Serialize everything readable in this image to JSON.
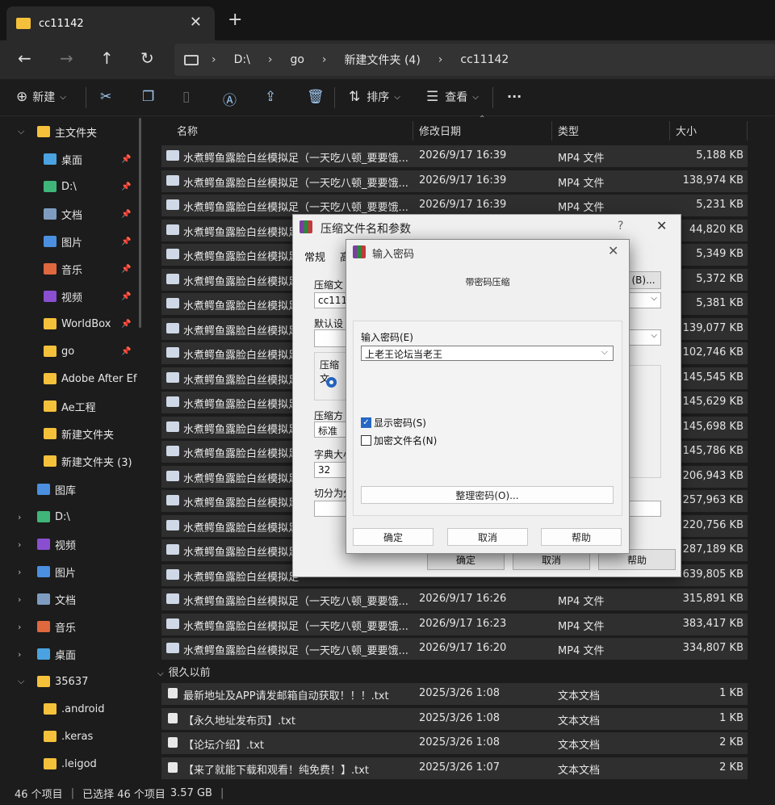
{
  "window": {
    "tab_title": "cc11142",
    "tab_close": "✕",
    "new_tab": "+"
  },
  "nav": {
    "back": "←",
    "forward": "→",
    "up": "↑",
    "refresh": "↻",
    "breadcrumbs": [
      "D:\\",
      "go",
      "新建文件夹 (4)",
      "cc11142"
    ],
    "separator": "›"
  },
  "toolbar": {
    "new_label": "新建",
    "sort_label": "排序",
    "view_label": "查看",
    "more_label": "···",
    "icons": [
      "cut-icon",
      "copy-icon",
      "paste-icon",
      "rename-icon",
      "share-icon",
      "delete-icon"
    ]
  },
  "sidebar": {
    "items": [
      {
        "label": "主文件夹",
        "icon": "home-icon",
        "color": "#f5c13b",
        "expanded": true
      },
      {
        "label": "桌面",
        "icon": "desktop-icon",
        "color": "#4aa3e0",
        "pinned": true
      },
      {
        "label": "D:\\",
        "icon": "download-icon",
        "color": "#3fb57a",
        "pinned": true
      },
      {
        "label": "文档",
        "icon": "document-icon",
        "color": "#7e9cc0",
        "pinned": true
      },
      {
        "label": "图片",
        "icon": "picture-icon",
        "color": "#4a8fe0",
        "pinned": true
      },
      {
        "label": "音乐",
        "icon": "music-icon",
        "color": "#e0683f",
        "pinned": true
      },
      {
        "label": "视频",
        "icon": "video-icon",
        "color": "#8a4fd0",
        "pinned": true
      },
      {
        "label": "WorldBox",
        "icon": "folder-icon",
        "color": "#f5c13b",
        "pinned": true
      },
      {
        "label": "go",
        "icon": "folder-icon",
        "color": "#f5c13b",
        "pinned": true
      },
      {
        "label": "Adobe After Ef",
        "icon": "folder-icon",
        "color": "#f5c13b"
      },
      {
        "label": "Ae工程",
        "icon": "folder-icon",
        "color": "#f5c13b"
      },
      {
        "label": "新建文件夹",
        "icon": "folder-icon",
        "color": "#f5c13b"
      },
      {
        "label": "新建文件夹 (3)",
        "icon": "folder-icon",
        "color": "#f5c13b"
      },
      {
        "label": "图库",
        "icon": "gallery-icon",
        "color": "#4a8fe0"
      },
      {
        "label": "D:\\",
        "icon": "download-icon",
        "color": "#3fb57a",
        "collapsed": true
      },
      {
        "label": "视频",
        "icon": "video-icon",
        "color": "#8a4fd0",
        "collapsed": true
      },
      {
        "label": "图片",
        "icon": "picture-icon",
        "color": "#4a8fe0",
        "collapsed": true
      },
      {
        "label": "文档",
        "icon": "document-icon",
        "color": "#7e9cc0",
        "collapsed": true
      },
      {
        "label": "音乐",
        "icon": "music-icon",
        "color": "#e0683f",
        "collapsed": true
      },
      {
        "label": "桌面",
        "icon": "desktop-icon",
        "color": "#4aa3e0",
        "collapsed": true
      },
      {
        "label": "35637",
        "icon": "folder-icon",
        "color": "#f5c13b",
        "expanded": true
      },
      {
        "label": ".android",
        "icon": "folder-icon",
        "color": "#f5c13b"
      },
      {
        "label": ".keras",
        "icon": "folder-icon",
        "color": "#f5c13b"
      },
      {
        "label": ".leigod",
        "icon": "folder-icon",
        "color": "#f5c13b"
      }
    ]
  },
  "columns": {
    "name": "名称",
    "date": "修改日期",
    "type": "类型",
    "size": "大小"
  },
  "files": [
    {
      "name": "水煮鳄鱼露脸白丝模拟足（一天吃八顿_要要饿...",
      "date": "2026/9/17 16:39",
      "type": "MP4 文件",
      "size": "5,188 KB"
    },
    {
      "name": "水煮鳄鱼露脸白丝模拟足（一天吃八顿_要要饿...",
      "date": "2026/9/17 16:39",
      "type": "MP4 文件",
      "size": "138,974 KB"
    },
    {
      "name": "水煮鳄鱼露脸白丝模拟足（一天吃八顿_要要饿...",
      "date": "2026/9/17 16:39",
      "type": "MP4 文件",
      "size": "5,231 KB"
    },
    {
      "name": "水煮鳄鱼露脸白丝模拟足",
      "date": "",
      "type": "",
      "size": "44,820 KB"
    },
    {
      "name": "水煮鳄鱼露脸白丝模拟足",
      "date": "",
      "type": "",
      "size": "5,349 KB"
    },
    {
      "name": "水煮鳄鱼露脸白丝模拟足",
      "date": "",
      "type": "",
      "size": "5,372 KB"
    },
    {
      "name": "水煮鳄鱼露脸白丝模拟足",
      "date": "",
      "type": "",
      "size": "5,381 KB"
    },
    {
      "name": "水煮鳄鱼露脸白丝模拟足",
      "date": "",
      "type": "",
      "size": "139,077 KB"
    },
    {
      "name": "水煮鳄鱼露脸白丝模拟足",
      "date": "",
      "type": "",
      "size": "102,746 KB"
    },
    {
      "name": "水煮鳄鱼露脸白丝模拟足",
      "date": "",
      "type": "",
      "size": "145,545 KB"
    },
    {
      "name": "水煮鳄鱼露脸白丝模拟足",
      "date": "",
      "type": "",
      "size": "145,629 KB"
    },
    {
      "name": "水煮鳄鱼露脸白丝模拟足",
      "date": "",
      "type": "",
      "size": "145,698 KB"
    },
    {
      "name": "水煮鳄鱼露脸白丝模拟足",
      "date": "",
      "type": "",
      "size": "145,786 KB"
    },
    {
      "name": "水煮鳄鱼露脸白丝模拟足",
      "date": "",
      "type": "",
      "size": "206,943 KB"
    },
    {
      "name": "水煮鳄鱼露脸白丝模拟足",
      "date": "",
      "type": "",
      "size": "257,963 KB"
    },
    {
      "name": "水煮鳄鱼露脸白丝模拟足",
      "date": "",
      "type": "",
      "size": "220,756 KB"
    },
    {
      "name": "水煮鳄鱼露脸白丝模拟足",
      "date": "",
      "type": "",
      "size": "287,189 KB"
    },
    {
      "name": "水煮鳄鱼露脸白丝模拟足",
      "date": "",
      "type": "",
      "size": "639,805 KB"
    },
    {
      "name": "水煮鳄鱼露脸白丝模拟足（一天吃八顿_要要饿...",
      "date": "2026/9/17 16:26",
      "type": "MP4 文件",
      "size": "315,891 KB"
    },
    {
      "name": "水煮鳄鱼露脸白丝模拟足（一天吃八顿_要要饿...",
      "date": "2026/9/17 16:23",
      "type": "MP4 文件",
      "size": "383,417 KB"
    },
    {
      "name": "水煮鳄鱼露脸白丝模拟足（一天吃八顿_要要饿...",
      "date": "2026/9/17 16:20",
      "type": "MP4 文件",
      "size": "334,807 KB"
    }
  ],
  "group_label": "很久以前",
  "txt_files": [
    {
      "name": "最新地址及APP请发邮箱自动获取！！！.txt",
      "date": "2025/3/26 1:08",
      "type": "文本文档",
      "size": "1 KB"
    },
    {
      "name": "【永久地址发布页】.txt",
      "date": "2025/3/26 1:08",
      "type": "文本文档",
      "size": "1 KB"
    },
    {
      "name": "【论坛介绍】.txt",
      "date": "2025/3/26 1:08",
      "type": "文本文档",
      "size": "2 KB"
    },
    {
      "name": "【来了就能下载和观看！纯免费！】.txt",
      "date": "2025/3/26 1:07",
      "type": "文本文档",
      "size": "2 KB"
    }
  ],
  "status": {
    "count": "46 个项目",
    "selected": "已选择 46 个项目",
    "size": "3.57 GB",
    "divider": "|"
  },
  "archive_dialog": {
    "title": "压缩文件名和参数",
    "help_q": "?",
    "close": "✕",
    "tab_general": "常规",
    "tab_2": "高",
    "label_archive_name": "压缩文",
    "archive_name_value": "cc1114",
    "browse_label": "(B)...",
    "label_default_profile": "默认设",
    "label_format": "压缩文",
    "label_method": "压缩方",
    "method_value": "标准",
    "label_dict": "字典大小",
    "dict_value": "32",
    "label_split": "切分为分",
    "ok": "确定",
    "cancel": "取消",
    "help": "帮助"
  },
  "password_dialog": {
    "title": "输入密码",
    "close": "✕",
    "heading": "带密码压缩",
    "label_enter": "输入密码(E)",
    "password_value": "上老王论坛当老王",
    "dropdown": "⌵",
    "show_password": "显示密码(S)",
    "show_checked": true,
    "encrypt_names": "加密文件名(N)",
    "encrypt_checked": false,
    "manage": "整理密码(O)...",
    "ok": "确定",
    "cancel": "取消",
    "help": "帮助"
  }
}
